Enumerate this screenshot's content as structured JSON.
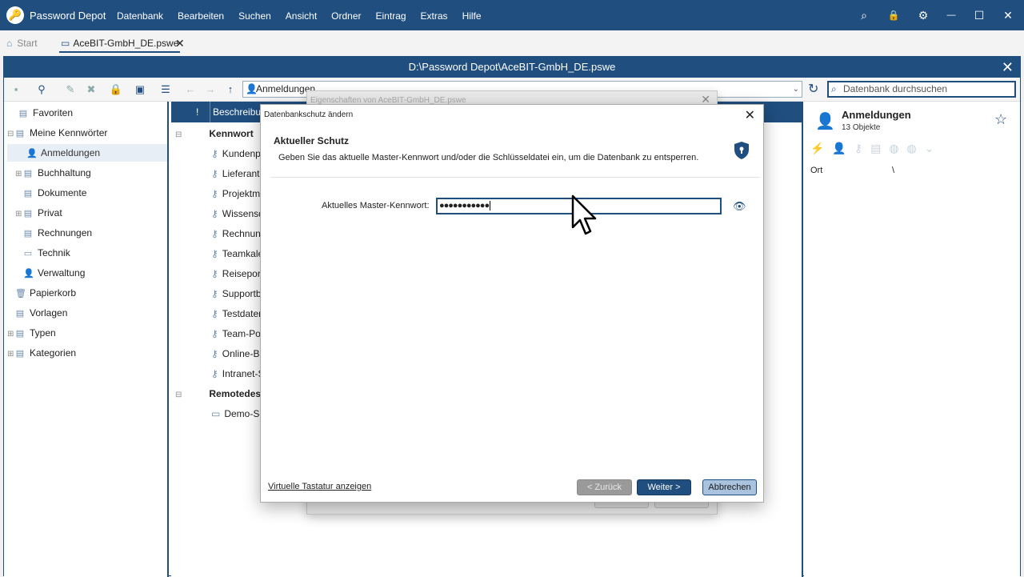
{
  "app": {
    "name": "Password Depot",
    "logo_glyph": "🔑"
  },
  "menu": [
    "Datenbank",
    "Bearbeiten",
    "Suchen",
    "Ansicht",
    "Ordner",
    "Eintrag",
    "Extras",
    "Hilfe"
  ],
  "window_controls": {
    "search": "⌕",
    "lock": "🔒",
    "settings": "⚙",
    "minimize": "—",
    "maximize": "☐",
    "close": "✕"
  },
  "tabs": {
    "start": "Start",
    "file": "AceBIT-GmbH_DE.pswe",
    "close": "✕"
  },
  "path": {
    "title": "D:\\Password Depot\\AceBIT-GmbH_DE.pswe",
    "close": "✕"
  },
  "toolbar": {
    "combo_value": "Anmeldungen",
    "search_placeholder": "Datenbank durchsuchen"
  },
  "tree": [
    {
      "label": "Favoriten",
      "icon": "star-folder"
    },
    {
      "label": "Meine Kennwörter",
      "icon": "folder",
      "expanded": true
    },
    {
      "label": "Anmeldungen",
      "icon": "user",
      "selected": true
    },
    {
      "label": "Buchhaltung",
      "icon": "folder"
    },
    {
      "label": "Dokumente",
      "icon": "folder"
    },
    {
      "label": "Privat",
      "icon": "folder"
    },
    {
      "label": "Rechnungen",
      "icon": "folder"
    },
    {
      "label": "Technik",
      "icon": "folder"
    },
    {
      "label": "Verwaltung",
      "icon": "user"
    },
    {
      "label": "Papierkorb",
      "icon": "trash"
    },
    {
      "label": "Vorlagen",
      "icon": "folder"
    },
    {
      "label": "Typen",
      "icon": "folder"
    },
    {
      "label": "Kategorien",
      "icon": "folder"
    }
  ],
  "list": {
    "header": {
      "flag": "!",
      "col1": "Beschreibun"
    },
    "groups": [
      {
        "label": "Kennwort",
        "items": [
          "Kundenpo",
          "Lieferante",
          "Projektma",
          "Wissensd",
          "Rechnung",
          "Teamkaler",
          "Reiseport",
          "Supportb",
          "Testdaten",
          "Team-Pos",
          "Online-Ba",
          "Intranet-S"
        ]
      },
      {
        "label": "Remotedesk",
        "items": [
          "Demo-Se"
        ]
      }
    ]
  },
  "right_panel": {
    "title": "Anmeldungen",
    "count": "13 Objekte",
    "field_label": "Ort",
    "field_value": "\\"
  },
  "bg_dialog": {
    "title": "Eigenschaften von AceBIT-GmbH_DE.pswe",
    "close": "✕"
  },
  "dialog": {
    "title": "Datenbankschutz ändern",
    "close": "✕",
    "heading": "Aktueller Schutz",
    "description": "Geben Sie das aktuelle Master-Kennwort und/oder die Schlüsseldatei ein, um die Datenbank zu entsperren.",
    "password_label": "Aktuelles Master-Kennwort:",
    "password_value": "●●●●●●●●●●●",
    "virtual_keyboard_link": "Virtuelle Tastatur anzeigen",
    "back_button": "< Zurück",
    "next_button": "Weiter >",
    "cancel_button": "Abbrechen"
  },
  "colors": {
    "brand": "#1f4e7f",
    "cancel_bg": "#a9c3df",
    "disabled": "#9a9a9a"
  }
}
